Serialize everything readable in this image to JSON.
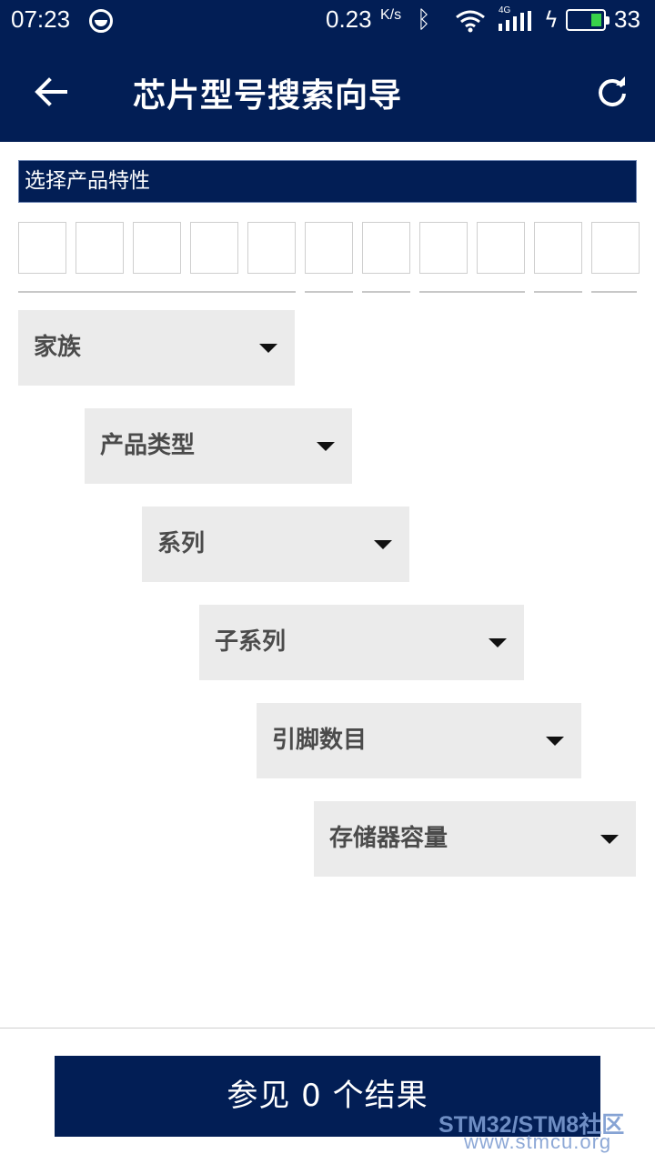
{
  "status_bar": {
    "time": "07:23",
    "speed": "0.23",
    "speed_unit": "K/s",
    "network_label": "4G",
    "battery_level": "33",
    "battery_color": "#39d24a"
  },
  "app_bar": {
    "title": "芯片型号搜索向导",
    "back_icon": "arrow-left-icon",
    "refresh_icon": "refresh-icon",
    "background": "#021e55"
  },
  "section": {
    "title": "选择产品特性"
  },
  "part_number": {
    "boxes": [
      "",
      "",
      "",
      "",
      "",
      "",
      "",
      "",
      "",
      "",
      ""
    ]
  },
  "filters": [
    {
      "label": "家族"
    },
    {
      "label": "产品类型"
    },
    {
      "label": "系列"
    },
    {
      "label": "子系列"
    },
    {
      "label": "引脚数目"
    },
    {
      "label": "存储器容量"
    }
  ],
  "results_button": {
    "label": "参见 0 个结果"
  },
  "watermark": {
    "line1": "STM32/STM8社区",
    "line2": "www.stmcu.org"
  }
}
